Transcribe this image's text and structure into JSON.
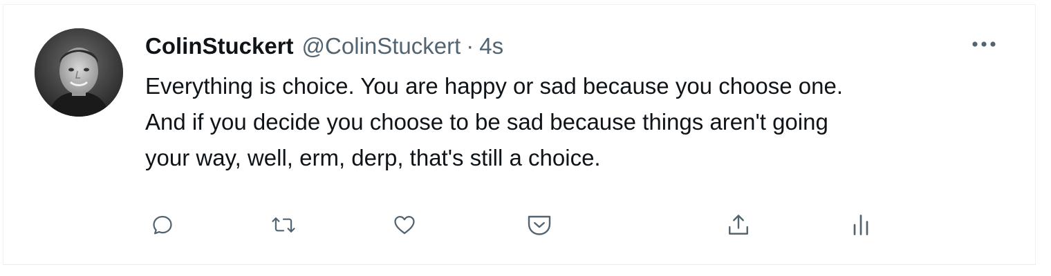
{
  "tweet": {
    "display_name": "ColinStuckert",
    "handle": "@ColinStuckert",
    "separator": "·",
    "timestamp": "4s",
    "text_lines": [
      "Everything is choice. You are happy or sad because you choose one.",
      "And if you decide you choose to be sad because things aren't going",
      "your way, well, erm, derp, that's still a choice."
    ]
  },
  "icons": {
    "more": "more-horizontal-icon",
    "avatar": "profile-photo",
    "actions": [
      "reply-icon",
      "retweet-icon",
      "like-icon",
      "tip-icon",
      "share-icon",
      "analytics-icon"
    ]
  },
  "colors": {
    "text_primary": "#0f1419",
    "text_secondary": "#536471",
    "icon_gray": "#536471",
    "border": "#eff3f4"
  }
}
